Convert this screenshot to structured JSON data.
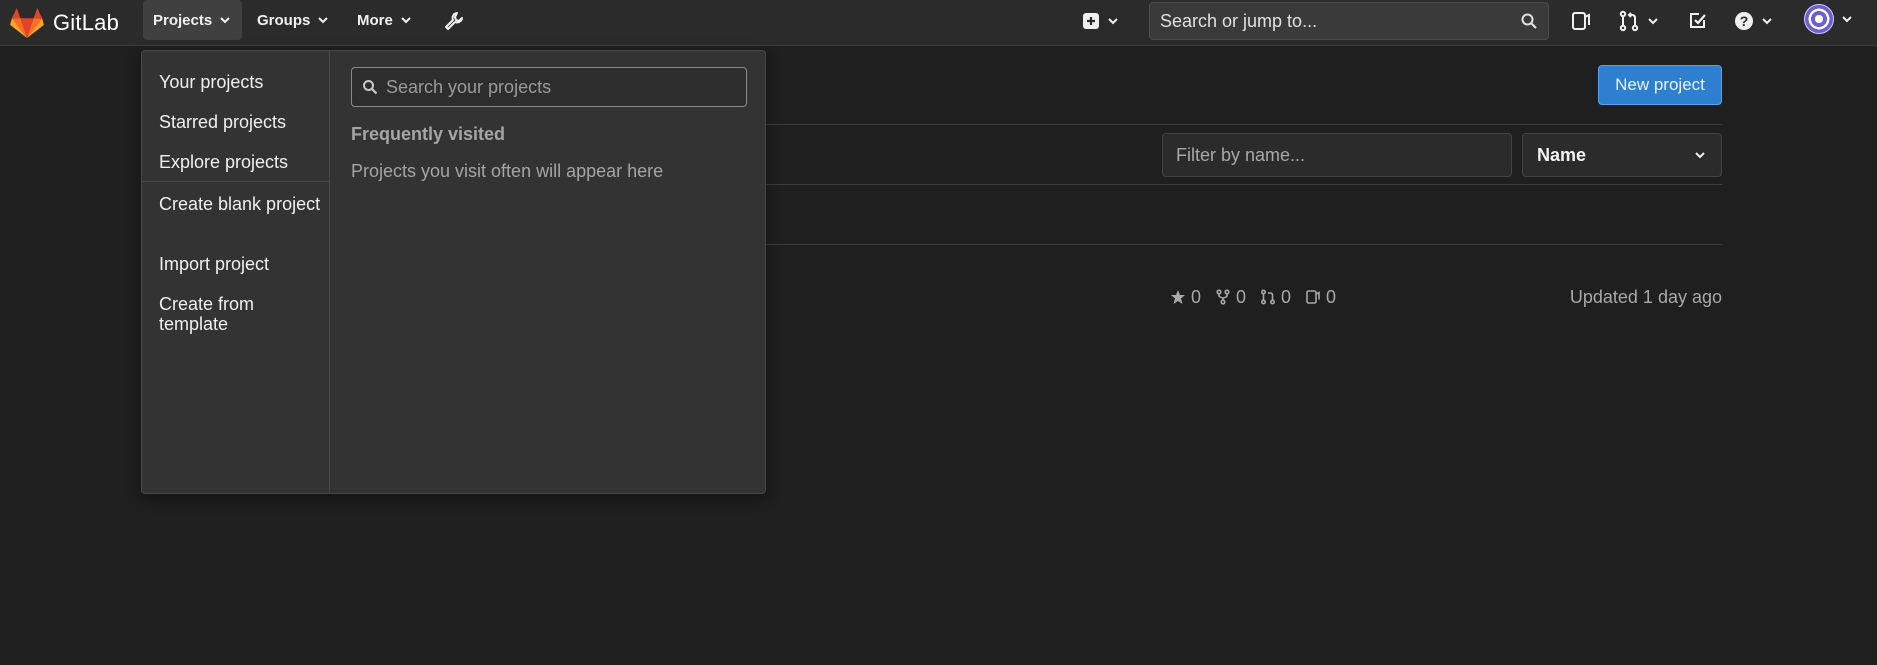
{
  "navbar": {
    "brand": "GitLab",
    "menus": [
      "Projects",
      "Groups",
      "More"
    ],
    "search_placeholder": "Search or jump to..."
  },
  "projects_dropdown": {
    "items": [
      "Your projects",
      "Starred projects",
      "Explore projects",
      "Create blank project",
      "Import project",
      "Create from template"
    ],
    "search_placeholder": "Search your projects",
    "frequent_heading": "Frequently visited",
    "frequent_empty": "Projects you visit often will appear here"
  },
  "page": {
    "new_project_label": "New project",
    "filter_placeholder": "Filter by name...",
    "sort_value": "Name",
    "project_row": {
      "stars": "0",
      "forks": "0",
      "merge_requests": "0",
      "issues": "0",
      "updated": "Updated 1 day ago"
    }
  },
  "colors": {
    "brand_orange": "#e24329",
    "primary_button": "#2f7fd0",
    "navbar_bg": "#2b2b2b",
    "page_bg": "#1f1f1f"
  },
  "icons": [
    "gitlab-logo-icon",
    "chevron-down-icon",
    "wrench-icon",
    "plus-square-icon",
    "search-icon",
    "issues-icon",
    "merge-request-icon",
    "todo-icon",
    "help-icon",
    "avatar",
    "star-icon",
    "fork-icon"
  ]
}
